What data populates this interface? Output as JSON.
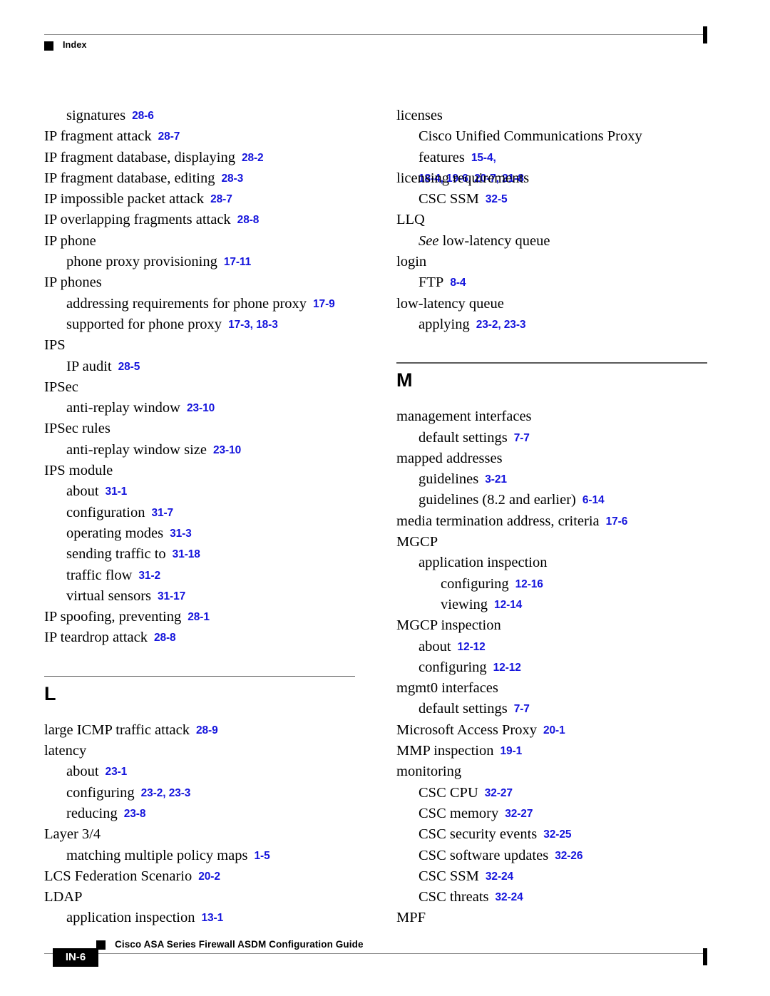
{
  "header": {
    "label": "Index",
    "marker_icon": "square-bullet-icon"
  },
  "footer": {
    "title": "Cisco ASA Series Firewall ASDM Configuration Guide",
    "folio": "IN-6",
    "marker_icon": "square-bullet-icon"
  },
  "colors": {
    "page_reference": "#1414DC",
    "rule": "#8A8A8A",
    "text": "#000000"
  },
  "columns": [
    {
      "name": "left-column",
      "blocks": [
        {
          "type": "entries",
          "entries": [
            {
              "level": 1,
              "term": "signatures",
              "ref": "28-6"
            },
            {
              "level": 0,
              "term": "IP fragment attack",
              "ref": "28-7"
            },
            {
              "level": 0,
              "term": "IP fragment database, displaying",
              "ref": "28-2"
            },
            {
              "level": 0,
              "term": "IP fragment database, editing",
              "ref": "28-3"
            },
            {
              "level": 0,
              "term": "IP impossible packet attack",
              "ref": "28-7"
            },
            {
              "level": 0,
              "term": "IP overlapping fragments attack",
              "ref": "28-8"
            },
            {
              "level": 0,
              "term": "IP phone",
              "ref": ""
            },
            {
              "level": 1,
              "term": "phone proxy provisioning",
              "ref": "17-11"
            },
            {
              "level": 0,
              "term": "IP phones",
              "ref": ""
            },
            {
              "level": 1,
              "term": "addressing requirements for phone proxy",
              "ref": "17-9"
            },
            {
              "level": 1,
              "term": "supported for phone proxy",
              "ref": "17-3, 18-3"
            },
            {
              "level": 0,
              "term": "IPS",
              "ref": ""
            },
            {
              "level": 1,
              "term": "IP audit",
              "ref": "28-5"
            },
            {
              "level": 0,
              "term": "IPSec",
              "ref": ""
            },
            {
              "level": 1,
              "term": "anti-replay window",
              "ref": "23-10"
            },
            {
              "level": 0,
              "term": "IPSec rules",
              "ref": ""
            },
            {
              "level": 1,
              "term": "anti-replay window size",
              "ref": "23-10"
            },
            {
              "level": 0,
              "term": "IPS module",
              "ref": ""
            },
            {
              "level": 1,
              "term": "about",
              "ref": "31-1"
            },
            {
              "level": 1,
              "term": "configuration",
              "ref": "31-7"
            },
            {
              "level": 1,
              "term": "operating modes",
              "ref": "31-3"
            },
            {
              "level": 1,
              "term": "sending traffic to",
              "ref": "31-18"
            },
            {
              "level": 1,
              "term": "traffic flow",
              "ref": "31-2"
            },
            {
              "level": 1,
              "term": "virtual sensors",
              "ref": "31-17"
            },
            {
              "level": 0,
              "term": "IP spoofing, preventing",
              "ref": "28-1"
            },
            {
              "level": 0,
              "term": "IP teardrop attack",
              "ref": "28-8"
            }
          ]
        },
        {
          "type": "letter-break",
          "letter": "L"
        },
        {
          "type": "entries",
          "entries": [
            {
              "level": 0,
              "term": "large ICMP traffic attack",
              "ref": "28-9"
            },
            {
              "level": 0,
              "term": "latency",
              "ref": ""
            },
            {
              "level": 1,
              "term": "about",
              "ref": "23-1"
            },
            {
              "level": 1,
              "term": "configuring",
              "ref": "23-2, 23-3"
            },
            {
              "level": 1,
              "term": "reducing",
              "ref": "23-8"
            },
            {
              "level": 0,
              "term": "Layer 3/4",
              "ref": ""
            },
            {
              "level": 1,
              "term": "matching multiple policy maps",
              "ref": "1-5"
            },
            {
              "level": 0,
              "term": "LCS Federation Scenario",
              "ref": "20-2"
            },
            {
              "level": 0,
              "term": "LDAP",
              "ref": ""
            },
            {
              "level": 1,
              "term": "application inspection",
              "ref": "13-1"
            }
          ]
        }
      ]
    },
    {
      "name": "right-column",
      "blocks": [
        {
          "type": "entries",
          "entries": [
            {
              "level": 0,
              "term": "licenses",
              "ref": ""
            },
            {
              "level": 1,
              "term": "Cisco Unified Communications Proxy features",
              "ref": "15-4,",
              "ref_continued": "18-4, 19-6, 20-7, 21-8"
            },
            {
              "level": 0,
              "term": "licensing requirements",
              "ref": ""
            },
            {
              "level": 1,
              "term": "CSC SSM",
              "ref": "32-5"
            },
            {
              "level": 0,
              "term": "LLQ",
              "ref": ""
            },
            {
              "level": 1,
              "term": "See low-latency queue",
              "ref": "",
              "see_prefix": "See",
              "see_target": "low-latency queue"
            },
            {
              "level": 0,
              "term": "login",
              "ref": ""
            },
            {
              "level": 1,
              "term": "FTP",
              "ref": "8-4"
            },
            {
              "level": 0,
              "term": "low-latency queue",
              "ref": ""
            },
            {
              "level": 1,
              "term": "applying",
              "ref": "23-2, 23-3"
            }
          ]
        },
        {
          "type": "letter-break",
          "letter": "M"
        },
        {
          "type": "entries",
          "entries": [
            {
              "level": 0,
              "term": "management interfaces",
              "ref": ""
            },
            {
              "level": 1,
              "term": "default settings",
              "ref": "7-7"
            },
            {
              "level": 0,
              "term": "mapped addresses",
              "ref": ""
            },
            {
              "level": 1,
              "term": "guidelines",
              "ref": "3-21"
            },
            {
              "level": 1,
              "term": "guidelines (8.2 and earlier)",
              "ref": "6-14"
            },
            {
              "level": 0,
              "term": "media termination address, criteria",
              "ref": "17-6"
            },
            {
              "level": 0,
              "term": "MGCP",
              "ref": ""
            },
            {
              "level": 1,
              "term": "application inspection",
              "ref": ""
            },
            {
              "level": 2,
              "term": "configuring",
              "ref": "12-16"
            },
            {
              "level": 2,
              "term": "viewing",
              "ref": "12-14"
            },
            {
              "level": 0,
              "term": "MGCP inspection",
              "ref": ""
            },
            {
              "level": 1,
              "term": "about",
              "ref": "12-12"
            },
            {
              "level": 1,
              "term": "configuring",
              "ref": "12-12"
            },
            {
              "level": 0,
              "term": "mgmt0 interfaces",
              "ref": ""
            },
            {
              "level": 1,
              "term": "default settings",
              "ref": "7-7"
            },
            {
              "level": 0,
              "term": "Microsoft Access Proxy",
              "ref": "20-1"
            },
            {
              "level": 0,
              "term": "MMP inspection",
              "ref": "19-1"
            },
            {
              "level": 0,
              "term": "monitoring",
              "ref": ""
            },
            {
              "level": 1,
              "term": "CSC CPU",
              "ref": "32-27"
            },
            {
              "level": 1,
              "term": "CSC memory",
              "ref": "32-27"
            },
            {
              "level": 1,
              "term": "CSC security events",
              "ref": "32-25"
            },
            {
              "level": 1,
              "term": "CSC software updates",
              "ref": "32-26"
            },
            {
              "level": 1,
              "term": "CSC SSM",
              "ref": "32-24"
            },
            {
              "level": 1,
              "term": "CSC threats",
              "ref": "32-24"
            },
            {
              "level": 0,
              "term": "MPF",
              "ref": ""
            }
          ]
        }
      ]
    }
  ]
}
